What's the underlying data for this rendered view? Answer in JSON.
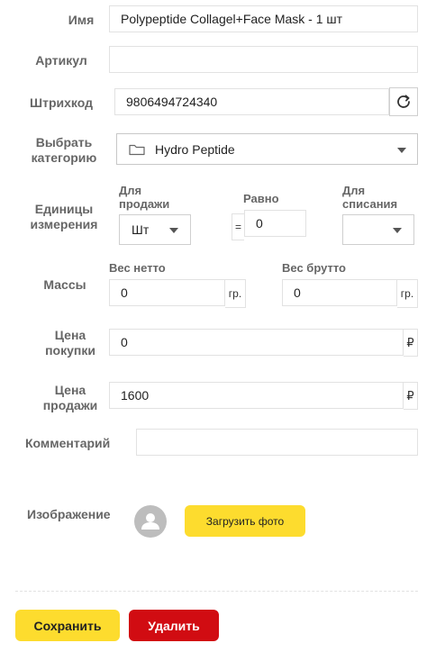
{
  "form": {
    "name": {
      "label": "Имя",
      "value": "Polypeptide Collagel+Face Mask - 1 шт"
    },
    "sku": {
      "label": "Артикул",
      "value": ""
    },
    "barcode": {
      "label": "Штрихкод",
      "value": "9806494724340",
      "refresh_icon": "refresh-icon"
    },
    "category": {
      "label_line1": "Выбрать",
      "label_line2": "категорию",
      "value": "Hydro Peptide",
      "icon": "folder-icon"
    },
    "units": {
      "label_line1": "Единицы",
      "label_line2": "измерения",
      "sale_label_line1": "Для",
      "sale_label_line2": "продажи",
      "sale_value": "Шт",
      "equals_label": "Равно",
      "equals_sign": "=",
      "equals_value": "0",
      "writeoff_label_line1": "Для",
      "writeoff_label_line2": "списания",
      "writeoff_value": ""
    },
    "mass": {
      "label": "Массы",
      "net_label": "Вес нетто",
      "net_value": "0",
      "net_unit": "гр.",
      "gross_label": "Вес брутто",
      "gross_value": "0",
      "gross_unit": "гр."
    },
    "purchase_price": {
      "label_line1": "Цена",
      "label_line2": "покупки",
      "value": "0",
      "currency": "₽"
    },
    "sale_price": {
      "label_line1": "Цена",
      "label_line2": "продажи",
      "value": "1600",
      "currency": "₽"
    },
    "comment": {
      "label": "Комментарий",
      "value": ""
    },
    "image": {
      "label": "Изображение",
      "upload_label": "Загрузить фото",
      "avatar_icon": "user-avatar-icon"
    }
  },
  "actions": {
    "save_label": "Сохранить",
    "delete_label": "Удалить"
  },
  "colors": {
    "yellow": "#fddc2e",
    "red": "#d10c12",
    "label": "#666666",
    "border": "#e2e2e2"
  }
}
